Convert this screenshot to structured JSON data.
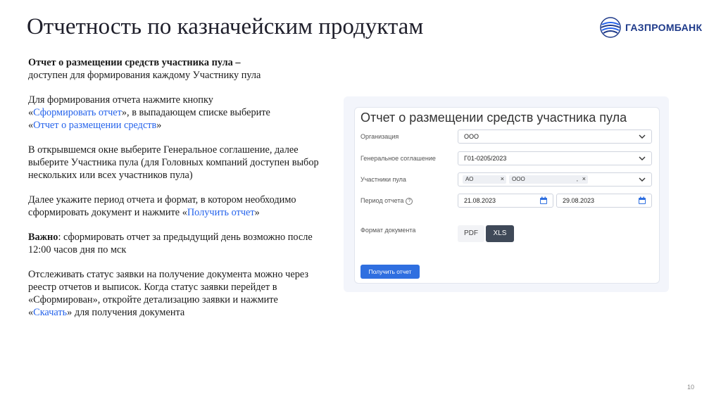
{
  "slide": {
    "title": "Отчетность по казначейским продуктам",
    "page_number": "10"
  },
  "logo": {
    "text": "ГАЗПРОМБАНК",
    "color": "#1e3a8a"
  },
  "instructions": {
    "p1_bold": "Отчет о размещении средств участника пула –",
    "p1_rest": "доступен для формирования каждому Участнику пула",
    "p2_a": "Для формирования отчета нажмите кнопку",
    "p2_b": "«",
    "p2_link1": "Сформировать отчет",
    "p2_c": "», в выпадающем списке выберите",
    "p2_d": "«",
    "p2_link2": "Отчет о размещении средств",
    "p2_e": "»",
    "p3": "В открывшемся окне выберите Генеральное соглашение, далее выберите Участника пула (для Головных компаний доступен выбор нескольких или всех участников пула)",
    "p4_a": "Далее укажите период отчета и формат, в котором необходимо сформировать документ и нажмите",
    "p4_b": "«",
    "p4_link": "Получить отчет",
    "p4_c": "»",
    "p5_bold": "Важно",
    "p5_rest": ": сформировать отчет за предыдущий день возможно после 12:00 часов дня по мск",
    "p6_a": "Отслеживать статус заявки на получение документа можно через реестр отчетов и выписок. Когда статус заявки перейдет в «Сформирован», откройте детализацию заявки и нажмите «",
    "p6_link": "Скачать",
    "p6_b": "» для получения документа",
    "link_color": "#2563eb"
  },
  "form": {
    "title": "Отчет о размещении средств участника пула",
    "organization_label": "Организация",
    "organization_value": "ООО",
    "agreement_label": "Генеральное соглашение",
    "agreement_value": "Г01-0205/2023",
    "participants_label": "Участники пула",
    "participant_tag1": "АО",
    "participant_tag2": "ООО",
    "participant_tag2_suffix": ",",
    "tag_remove": "×",
    "period_label": "Период отчета",
    "help_mark": "?",
    "date_from": "21.08.2023",
    "date_to": "29.08.2023",
    "format_label": "Формат документа",
    "format_pdf": "PDF",
    "format_xls": "XLS",
    "format_selected": "XLS",
    "submit_label": "Получить отчет",
    "accent_color": "#2f6fe0"
  }
}
